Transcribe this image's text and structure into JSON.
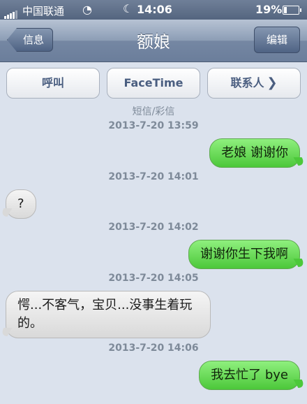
{
  "status": {
    "carrier": "中国联通",
    "time": "14:06",
    "battery": "19%",
    "battery_level": 0.19
  },
  "nav": {
    "back": "信息",
    "title": "额娘",
    "edit": "编辑"
  },
  "actions": {
    "call": "呼叫",
    "facetime": "FaceTime",
    "contact": "联系人"
  },
  "thread_type": "短信/彩信",
  "messages": [
    {
      "time": "2013-7-20 13:59",
      "text": "老娘 谢谢你",
      "dir": "out"
    },
    {
      "time": "2013-7-20 14:01",
      "text": "?",
      "dir": "in"
    },
    {
      "time": "2013-7-20 14:02",
      "text": "谢谢你生下我啊",
      "dir": "out"
    },
    {
      "time": "2013-7-20 14:05",
      "text": "愕...不客气，宝贝...没事生着玩的。",
      "dir": "in"
    },
    {
      "time": "2013-7-20 14:06",
      "text": "我去忙了 bye",
      "dir": "out"
    }
  ]
}
